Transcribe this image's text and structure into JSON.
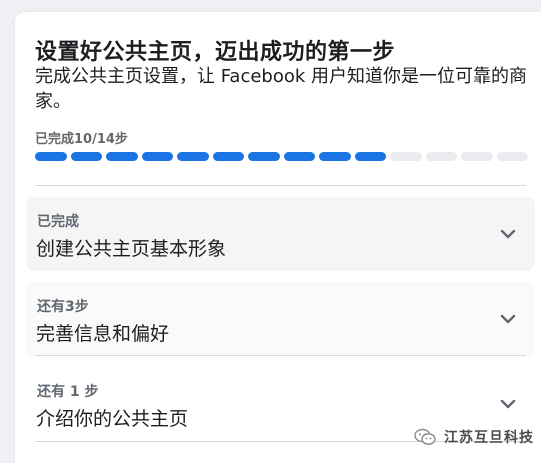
{
  "card": {
    "title": "设置好公共主页，迈出成功的第一步",
    "subtitle": "完成公共主页设置，让 Facebook 用户知道你是一位可靠的商家。",
    "progress_label": "已完成10/14步",
    "progress": {
      "completed": 10,
      "total": 14,
      "done_color": "#1b74e4",
      "todo_color": "#eaebee"
    }
  },
  "steps": [
    {
      "status": "已完成",
      "title": "创建公共主页基本形象",
      "icon": "chevron-down-icon",
      "background": "#f5f5f5"
    },
    {
      "status": "还有3步",
      "title": "完善信息和偏好",
      "icon": "chevron-down-icon",
      "background": "#fafafa"
    },
    {
      "status": "还有 1 步",
      "title": "介绍你的公共主页",
      "icon": "chevron-down-icon",
      "background": "#ffffff"
    }
  ],
  "watermark": {
    "text": "江苏互旦科技",
    "icon": "wechat-icon"
  }
}
